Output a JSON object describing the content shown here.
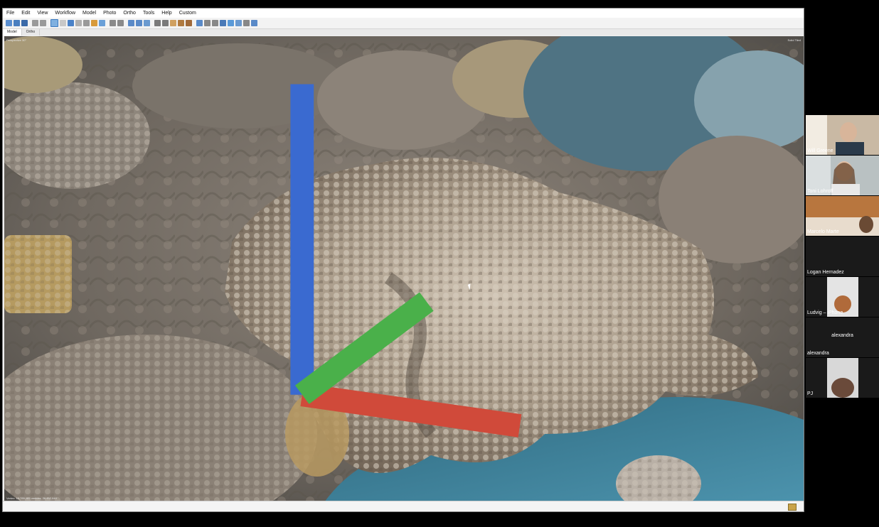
{
  "menu": [
    "File",
    "Edit",
    "View",
    "Workflow",
    "Model",
    "Photo",
    "Ortho",
    "Tools",
    "Help",
    "Custom"
  ],
  "tabs": [
    {
      "label": "Model",
      "active": true
    },
    {
      "label": "Ortho",
      "active": false
    }
  ],
  "viewport": {
    "corner_left": "Perspective 30°",
    "corner_right": "Solid  Tiled",
    "bottom_left": "Vertex: 14,789,183 vertices, 28,452,049"
  },
  "participants": [
    {
      "name": "Will Greene",
      "video": true
    },
    {
      "name": "Toni Lohroff",
      "video": true
    },
    {
      "name": "Marcelo Marte",
      "video": true
    },
    {
      "name": "Logan Hernadez",
      "video": false
    },
    {
      "name": "Ludvig – iPhone",
      "video": true
    },
    {
      "name": "alexandra",
      "video": false
    },
    {
      "name": "PJ",
      "video": true
    }
  ],
  "center_label": "alexandra",
  "colors": {
    "window_bg": "#f0f0f0",
    "coral": "#b8aa98",
    "water": "#3f7f96"
  }
}
